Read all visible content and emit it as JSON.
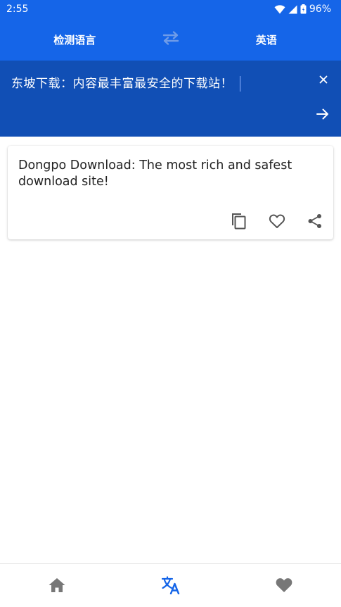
{
  "status_bar": {
    "time": "2:55",
    "battery": "96%"
  },
  "lang_bar": {
    "source_lang": "检测语言",
    "target_lang": "英语"
  },
  "input": {
    "text": "东坡下载：内容最丰富最安全的下载站！"
  },
  "result": {
    "text": "Dongpo Download: The most rich and safest download site!"
  },
  "colors": {
    "primary": "#1565e8",
    "input_bg": "#114fb5",
    "active_tab": "#1565e8",
    "inactive_tab": "#777777"
  },
  "bottom_nav": {
    "items": [
      {
        "icon": "home-icon",
        "active": false
      },
      {
        "icon": "translate-icon",
        "active": true
      },
      {
        "icon": "heart-icon",
        "active": false
      }
    ]
  }
}
